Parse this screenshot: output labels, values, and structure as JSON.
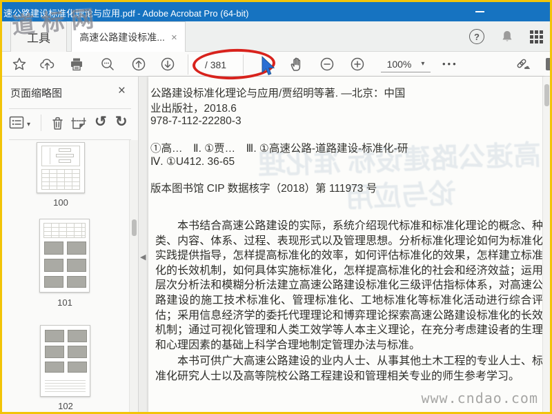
{
  "window": {
    "title": "速公路建设标准化理论与应用.pdf - Adobe Acrobat Pro (64-bit)"
  },
  "watermarks": {
    "top_left": "道标网",
    "bottom_right": "www.cndao.com"
  },
  "tabs": {
    "tools_label": "工具",
    "document_label": "高速公路建设标准...",
    "document_close": "×"
  },
  "toolbar": {
    "page_indicator": "/ 381",
    "zoom_level": "100%",
    "more_label": "•••"
  },
  "icons": {
    "caret_down": "▾",
    "collapse_left": "◀",
    "rotate_left": "↺",
    "rotate_right": "↻",
    "close": "×",
    "help": "?"
  },
  "sidebar": {
    "title": "页面缩略图",
    "thumbnails": [
      {
        "page": "100"
      },
      {
        "page": "101"
      },
      {
        "page": "102"
      }
    ]
  },
  "document": {
    "cip_lines": [
      "公路建设标准化理论与应用/贾绍明等著. —北京：中国",
      "业出版社，2018.6",
      "978-7-112-22280-3",
      "①高…　Ⅱ. ①贾…　Ⅲ. ①高速公路-道路建设-标准化-研",
      "Ⅳ. ①U412. 36-65",
      "版本图书馆 CIP 数据核字（2018）第 111973 号"
    ],
    "paragraphs": [
      "本书结合高速公路建设的实际，系统介绍现代标准和标准化理论的概念、种类、内容、体系、过程、表现形式以及管理思想。分析标准化理论如何为标准化实践提供指导，怎样提高标准化的效率，如何评估标准化的效果，怎样建立标准化的长效机制，如何具体实施标准化，怎样提高标准化的社会和经济效益；运用层次分析法和模糊分析法建立高速公路建设标准化三级评估指标体系，对高速公路建设的施工技术标准化、管理标准化、工地标准化等标准化活动进行综合评估；采用信息经济学的委托代理理论和博弈理论探索高速公路建设标准化的长效机制；通过可视化管理和人类工效学等人本主义理论，在充分考虑建设者的生理和心理因素的基础上科学合理地制定管理办法与标准。",
      "本书可供广大高速公路建设的业内人士、从事其他土木工程的专业人士、标准化研究人士以及高等院校公路工程建设和管理相关专业的师生参考学习。"
    ],
    "bleed_text": "高速公路建设标 准化理论与应用"
  },
  "colors": {
    "titlebar_blue": "#1673c1",
    "border_yellow": "#f2c408",
    "annotation_red": "#d8231d",
    "cursor_blue": "#2a6fd4"
  }
}
